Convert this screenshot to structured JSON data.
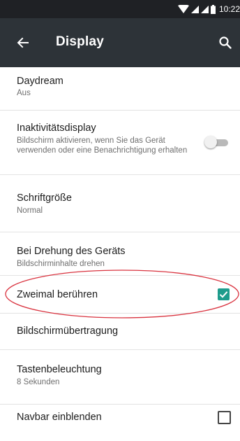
{
  "status_bar": {
    "time": "10:22",
    "icons": [
      "wifi-icon",
      "signal-icon",
      "battery-icon"
    ]
  },
  "app_bar": {
    "title": "Display",
    "back_icon": "arrow-left-icon",
    "search_icon": "search-icon"
  },
  "settings": [
    {
      "title": "Daydream",
      "subtitle": "Aus"
    },
    {
      "title": "Inaktivitätsdisplay",
      "subtitle": "Bildschirm aktivieren, wenn Sie das Gerät verwenden oder eine Benachrichtigung erhalten",
      "toggle_on": false
    },
    {
      "title": "Schriftgröße",
      "subtitle": "Normal"
    },
    {
      "title": "Bei Drehung des Geräts",
      "subtitle": "Bildschirminhalte drehen"
    },
    {
      "title": "Zweimal berühren",
      "checked": true
    },
    {
      "title": "Bildschirmübertragung"
    },
    {
      "title": "Tastenbeleuchtung",
      "subtitle": "8 Sekunden"
    },
    {
      "title": "Navbar einblenden",
      "checked": false
    }
  ],
  "colors": {
    "status_bar": "#1f2125",
    "app_bar": "#2d3338",
    "accent": "#1e9c8c",
    "highlight": "#d9333f"
  }
}
